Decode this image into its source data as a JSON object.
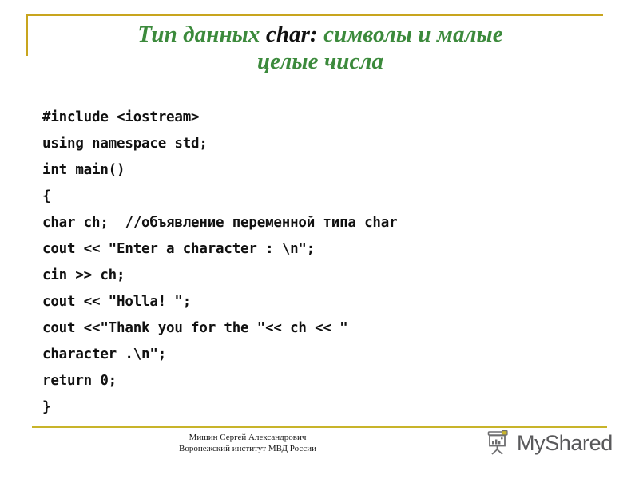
{
  "slide": {
    "title": {
      "line1_before": "Тип данных ",
      "keyword": "char:",
      "line1_after": " символы и малые",
      "line2": "целые числа",
      "color": "#3c8a3c",
      "keyword_color": "#111111"
    },
    "code": {
      "language": "cpp",
      "lines": [
        "#include <iostream>",
        "using namespace std;",
        "int main()",
        "{",
        "char ch;  //объявление переменной типа char",
        "cout << \"Enter a character : \\n\";",
        "cin >> ch;",
        "cout << \"Holla! \";",
        "cout <<\"Thank you for the \"<< ch << \"",
        "character .\\n\";",
        "return 0;",
        "}"
      ]
    },
    "footer": {
      "credit_line1": "Мишин Сергей Александрович",
      "credit_line2": "Воронежский институт МВД России",
      "brand_name": "MyShared",
      "brand_icon": "presentation-chart-icon",
      "rule_color": "#c8b42a",
      "brand_text_color": "#59595b"
    },
    "accent_color": "#c8a51e"
  }
}
